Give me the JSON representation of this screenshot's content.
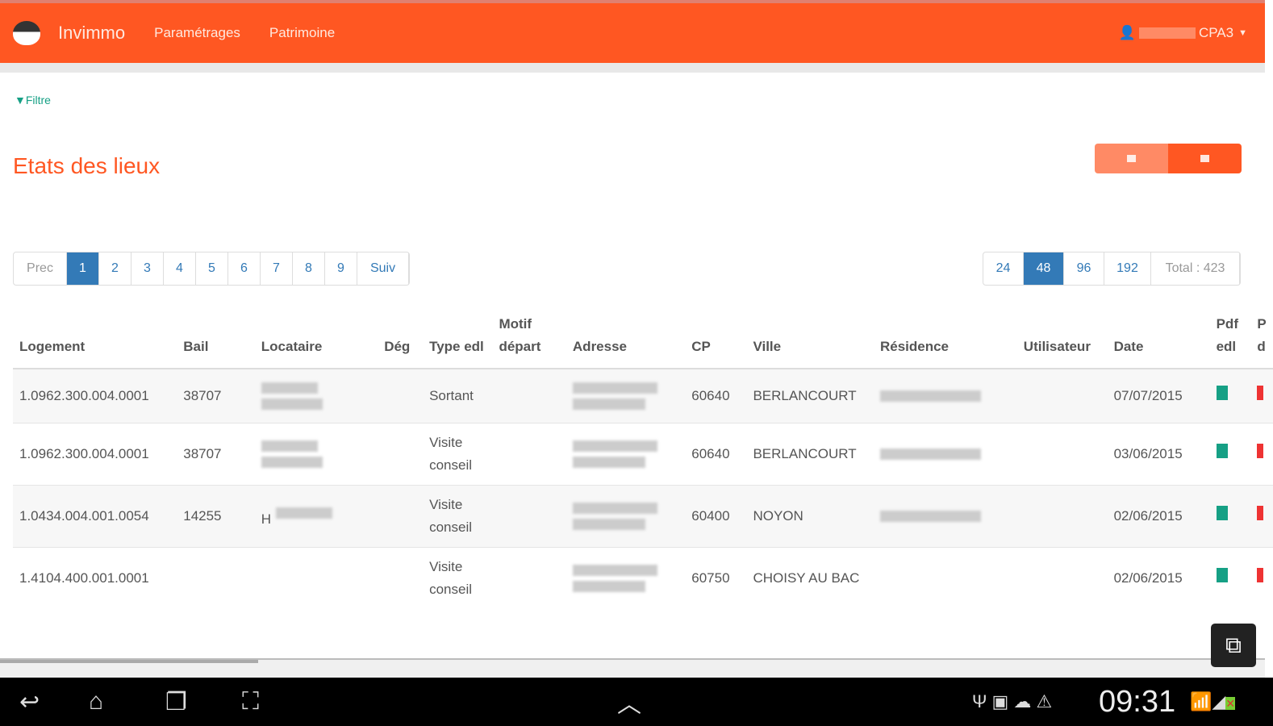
{
  "nav": {
    "brand": "Invimmo",
    "links": [
      "Paramétrages",
      "Patrimoine"
    ],
    "user": "CPA3"
  },
  "filter_label": "Filtre",
  "page_title": "Etats des lieux",
  "colors": {
    "accent": "#ff5722",
    "primary": "#337ab7",
    "filter": "#16a085"
  },
  "pagination": {
    "prev": "Prec",
    "pages": [
      "1",
      "2",
      "3",
      "4",
      "5",
      "6",
      "7",
      "8",
      "9"
    ],
    "next": "Suiv",
    "current": "1"
  },
  "page_size": {
    "options": [
      "24",
      "48",
      "96",
      "192"
    ],
    "selected": "48",
    "total": "Total : 423"
  },
  "table": {
    "headers": [
      "Logement",
      "Bail",
      "Locataire",
      "Dég",
      "Type edl",
      "Motif départ",
      "Adresse",
      "CP",
      "Ville",
      "Résidence",
      "Utilisateur",
      "Date",
      "Pdf edl",
      "P d"
    ],
    "rows": [
      {
        "logement": "1.0962.300.004.0001",
        "bail": "38707",
        "locataire": "",
        "type": "Sortant",
        "cp": "60640",
        "ville": "BERLANCOURT",
        "date": "07/07/2015"
      },
      {
        "logement": "1.0962.300.004.0001",
        "bail": "38707",
        "locataire": "",
        "type": "Visite conseil",
        "cp": "60640",
        "ville": "BERLANCOURT",
        "date": "03/06/2015"
      },
      {
        "logement": "1.0434.004.001.0054",
        "bail": "14255",
        "locataire": "H",
        "type": "Visite conseil",
        "cp": "60400",
        "ville": "NOYON",
        "date": "02/06/2015"
      },
      {
        "logement": "1.4104.400.001.0001",
        "bail": "",
        "locataire": "",
        "type": "Visite conseil",
        "cp": "60750",
        "ville": "CHOISY AU BAC",
        "date": "02/06/2015"
      }
    ]
  },
  "status": {
    "clock": "09:31"
  }
}
